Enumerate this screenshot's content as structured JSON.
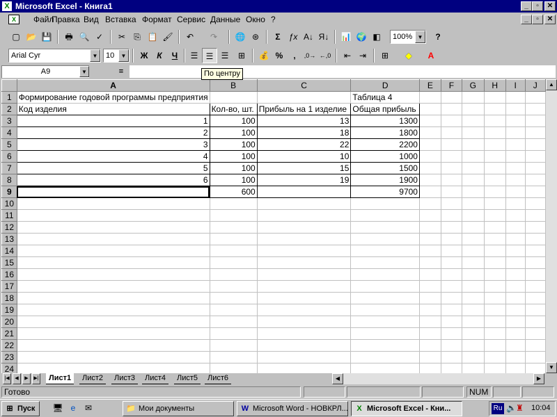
{
  "window": {
    "title": "Microsoft Excel - Книга1",
    "logo": "X"
  },
  "menu": [
    "Файл",
    "Правка",
    "Вид",
    "Вставка",
    "Формат",
    "Сервис",
    "Данные",
    "Окно",
    "?"
  ],
  "toolbar": {
    "zoom": "100%",
    "font": "Arial Cyr",
    "size": "10",
    "bold": "Ж",
    "italic": "К",
    "underline": "Ч"
  },
  "formula_bar": {
    "name_box": "A9",
    "eq": "=",
    "value": ""
  },
  "tooltip": "По центру",
  "sheet": {
    "columns": [
      "A",
      "B",
      "C",
      "D",
      "E",
      "F",
      "G",
      "H",
      "I",
      "J"
    ],
    "row_count": 24,
    "rows": [
      [
        "Формирование годовой программы предприятия",
        "",
        "",
        "Таблица 4"
      ],
      [
        "Код изделия",
        "Кол-во, шт.",
        "Прибыль на 1 изделие",
        "Общая прибыль"
      ],
      [
        "1",
        "100",
        "13",
        "1300"
      ],
      [
        "2",
        "100",
        "18",
        "1800"
      ],
      [
        "3",
        "100",
        "22",
        "2200"
      ],
      [
        "4",
        "100",
        "10",
        "1000"
      ],
      [
        "5",
        "100",
        "15",
        "1500"
      ],
      [
        "6",
        "100",
        "19",
        "1900"
      ],
      [
        "",
        "600",
        "",
        "9700"
      ]
    ]
  },
  "tabs": [
    "Лист1",
    "Лист2",
    "Лист3",
    "Лист4",
    "Лист5",
    "Лист6"
  ],
  "status": {
    "text": "Готово",
    "num": "NUM"
  },
  "taskbar": {
    "start": "Пуск",
    "buttons": [
      "Мои документы",
      "Microsoft Word - НОВКРЛ...",
      "Microsoft Excel - Кни..."
    ],
    "lang": "Ru",
    "clock": "10:04"
  }
}
